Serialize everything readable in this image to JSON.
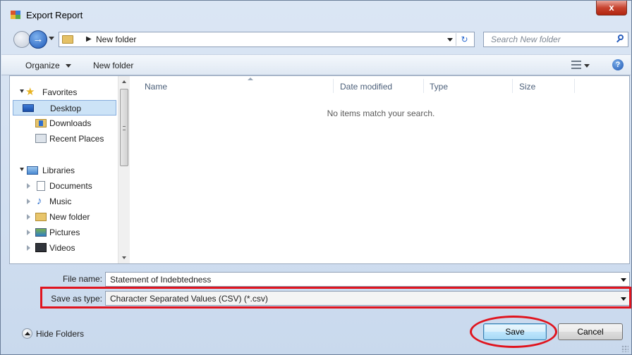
{
  "window": {
    "title": "Export Report",
    "close_glyph": "x"
  },
  "nav": {
    "back_icon": "back-arrow-icon",
    "forward_glyph": "→",
    "breadcrumb_sep": "▶",
    "address": "New folder",
    "refresh_glyph": "↻",
    "search_placeholder": "Search New folder"
  },
  "toolbar": {
    "organize": "Organize",
    "new_folder": "New folder",
    "help_glyph": "?"
  },
  "sidebar": {
    "items": [
      {
        "label": "Favorites",
        "icon": "star-icon"
      },
      {
        "label": "Desktop",
        "icon": "desktop-icon"
      },
      {
        "label": "Downloads",
        "icon": "downloads-icon"
      },
      {
        "label": "Recent Places",
        "icon": "recent-places-icon"
      },
      {
        "label": "Libraries",
        "icon": "libraries-icon"
      },
      {
        "label": "Documents",
        "icon": "documents-icon"
      },
      {
        "label": "Music",
        "icon": "music-icon"
      },
      {
        "label": "New folder",
        "icon": "folder-icon"
      },
      {
        "label": "Pictures",
        "icon": "pictures-icon"
      },
      {
        "label": "Videos",
        "icon": "videos-icon"
      }
    ],
    "selected": "Desktop"
  },
  "list": {
    "columns": [
      "Name",
      "Date modified",
      "Type",
      "Size"
    ],
    "empty_message": "No items match your search."
  },
  "form": {
    "file_name_label": "File name:",
    "file_name_value": "Statement of Indebtedness",
    "save_type_label": "Save as type:",
    "save_type_value": "Character Separated Values (CSV) (*.csv)"
  },
  "footer": {
    "hide_folders": "Hide Folders",
    "save": "Save",
    "cancel": "Cancel"
  },
  "annotation_color": "#e0141e"
}
